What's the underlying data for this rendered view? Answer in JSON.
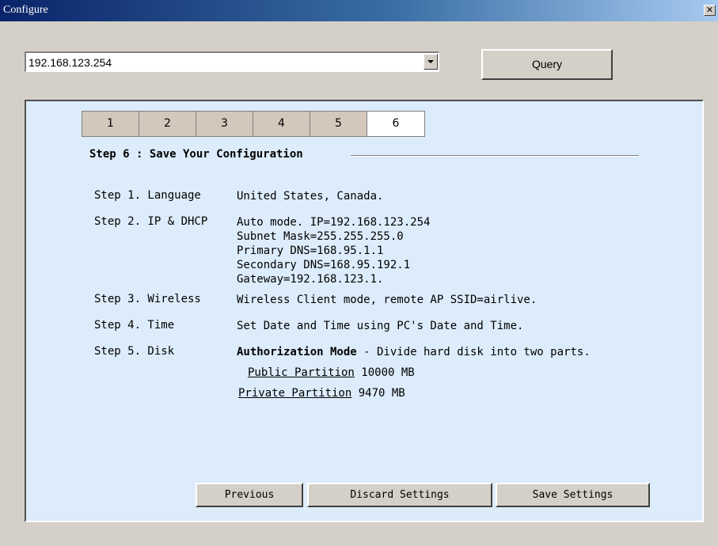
{
  "window": {
    "title": "Configure",
    "close_icon": "✕"
  },
  "ip_select": {
    "value": "192.168.123.254"
  },
  "query_button": {
    "label": "Query"
  },
  "tabs": [
    {
      "label": "1",
      "active": false
    },
    {
      "label": "2",
      "active": false
    },
    {
      "label": "3",
      "active": false
    },
    {
      "label": "4",
      "active": false
    },
    {
      "label": "5",
      "active": false
    },
    {
      "label": "6",
      "active": true
    }
  ],
  "step": {
    "heading": "Step 6 : Save Your Configuration"
  },
  "summary": {
    "language": {
      "label": "Step 1. Language",
      "value": "United States, Canada."
    },
    "ip": {
      "label": "Step 2. IP & DHCP",
      "lines": [
        "Auto mode. IP=192.168.123.254",
        "Subnet Mask=255.255.255.0",
        "Primary DNS=168.95.1.1",
        "Secondary DNS=168.95.192.1",
        "Gateway=192.168.123.1."
      ]
    },
    "wireless": {
      "label": "Step 3. Wireless",
      "value": "Wireless Client mode, remote AP SSID=airlive."
    },
    "time": {
      "label": "Step 4. Time",
      "value": "Set Date and Time using PC's Date and Time."
    },
    "disk": {
      "label": "Step 5. Disk",
      "mode": "Authorization Mode",
      "mode_desc": " - Divide hard disk into two parts.",
      "public_label": "Public Partition",
      "public_size": " 10000 MB",
      "private_label": "Private Partition",
      "private_size": " 9470 MB"
    }
  },
  "buttons": {
    "previous": "Previous",
    "discard": "Discard Settings",
    "save": "Save Settings"
  }
}
